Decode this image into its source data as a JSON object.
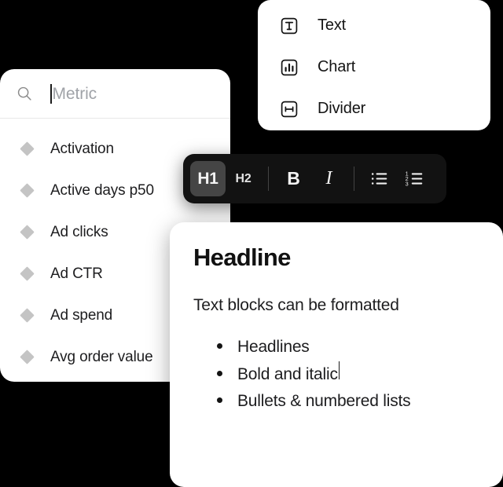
{
  "theme": {
    "background": "#000000",
    "card_background": "#ffffff",
    "toolbar_background": "#121212",
    "toolbar_active_background": "#454545",
    "text_primary": "#1d1d1f",
    "text_placeholder": "#a0a3a8",
    "diamond_color": "#c4c4c4"
  },
  "metric_panel": {
    "search": {
      "icon": "search-icon",
      "placeholder": "Metric",
      "value": ""
    },
    "items": [
      {
        "icon": "diamond-icon",
        "label": "Activation"
      },
      {
        "icon": "diamond-icon",
        "label": "Active days p50"
      },
      {
        "icon": "diamond-icon",
        "label": "Ad clicks"
      },
      {
        "icon": "diamond-icon",
        "label": "Ad CTR"
      },
      {
        "icon": "diamond-icon",
        "label": "Ad spend"
      },
      {
        "icon": "diamond-icon",
        "label": "Avg order value"
      }
    ]
  },
  "insert_panel": {
    "items": [
      {
        "icon": "text-block-icon",
        "label": "Text"
      },
      {
        "icon": "chart-block-icon",
        "label": "Chart"
      },
      {
        "icon": "divider-block-icon",
        "label": "Divider"
      }
    ]
  },
  "format_toolbar": {
    "buttons": [
      {
        "id": "h1",
        "label": "H1",
        "icon": "heading-1-icon",
        "active": true
      },
      {
        "id": "h2",
        "label": "H2",
        "icon": "heading-2-icon",
        "active": false
      },
      {
        "id": "bold",
        "label": "B",
        "icon": "bold-icon",
        "active": false
      },
      {
        "id": "italic",
        "label": "I",
        "icon": "italic-icon",
        "active": false
      },
      {
        "id": "bullet-list",
        "label": "",
        "icon": "bulleted-list-icon",
        "active": false
      },
      {
        "id": "numbered-list",
        "label": "",
        "icon": "numbered-list-icon",
        "active": false
      }
    ],
    "numbered_list_digits": [
      "1",
      "2",
      "3"
    ]
  },
  "document": {
    "headline": "Headline",
    "paragraph": "Text blocks can be formatted",
    "bullets": [
      {
        "text": "Headlines",
        "caret": false
      },
      {
        "text": "Bold and italic",
        "caret": true
      },
      {
        "text": "Bullets & numbered lists",
        "caret": false
      }
    ]
  }
}
